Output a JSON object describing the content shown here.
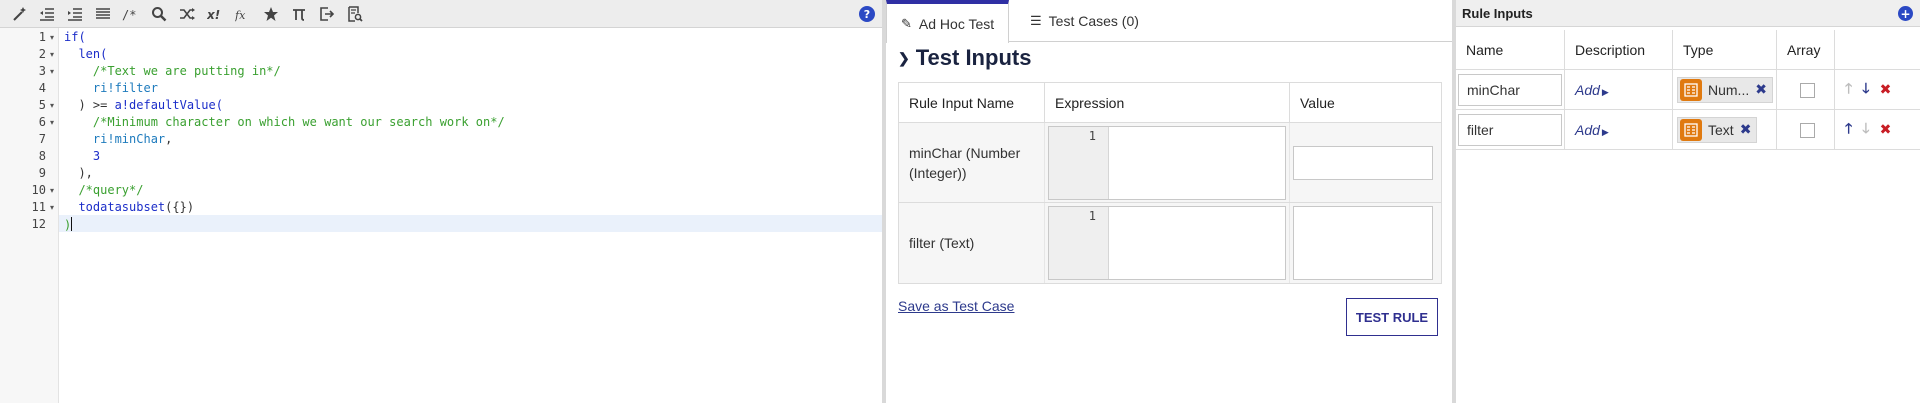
{
  "editor": {
    "toolbar": {
      "buttons": [
        "magic-wand-icon",
        "outdent-icon",
        "indent-icon",
        "list-icon",
        "comment-icon",
        "search-icon",
        "shuffle-icon",
        "exclaim-x-icon",
        "function-icon",
        "star-icon",
        "pi-icon",
        "export-icon",
        "document-search-icon"
      ],
      "help_label": "?"
    },
    "lines": [
      {
        "no": "1",
        "fold": "▾"
      },
      {
        "no": "2",
        "fold": "▾"
      },
      {
        "no": "3",
        "fold": "▾"
      },
      {
        "no": "4",
        "fold": ""
      },
      {
        "no": "5",
        "fold": "▾"
      },
      {
        "no": "6",
        "fold": "▾"
      },
      {
        "no": "7",
        "fold": ""
      },
      {
        "no": "8",
        "fold": ""
      },
      {
        "no": "9",
        "fold": ""
      },
      {
        "no": "10",
        "fold": "▾"
      },
      {
        "no": "11",
        "fold": "▾"
      },
      {
        "no": "12",
        "fold": ""
      }
    ],
    "code": {
      "l1_kw": "if(",
      "l2_kw": "len(",
      "l3_comment": "/*Text we are putting in*/",
      "l4_ref": "ri!filter",
      "l5_pre": ") >= ",
      "l5_kw": "a!defaultValue(",
      "l6_comment": "/*Minimum character on which we want our search work on*/",
      "l7_ref": "ri!minChar",
      "l7_post": ",",
      "l8_num": "3",
      "l9_text": "),",
      "l10_comment": "/*query*/",
      "l11_kw": "todatasubset",
      "l11_post": "({})",
      "l12_kw": ")"
    }
  },
  "test": {
    "tabs": [
      {
        "label": "Ad Hoc Test",
        "icon": "edit-icon"
      },
      {
        "label": "Test Cases (0)",
        "icon": "list-icon"
      }
    ],
    "section_title": "Test Inputs",
    "columns": [
      "Rule Input Name",
      "Expression",
      "Value"
    ],
    "rows": [
      {
        "name": "minChar (Number (Integer))",
        "line": "1"
      },
      {
        "name": "filter (Text)",
        "line": "1"
      }
    ],
    "save_link": "Save as Test Case",
    "test_button": "TEST RULE"
  },
  "rules": {
    "title": "Rule Inputs",
    "add_label": "+",
    "columns": [
      "Name",
      "Description",
      "Type",
      "Array",
      ""
    ],
    "rows": [
      {
        "name": "minChar",
        "desc": "Add",
        "type": "Num...",
        "remove": "✖"
      },
      {
        "name": "filter",
        "desc": "Add",
        "type": "Text",
        "remove": "✖"
      }
    ]
  }
}
